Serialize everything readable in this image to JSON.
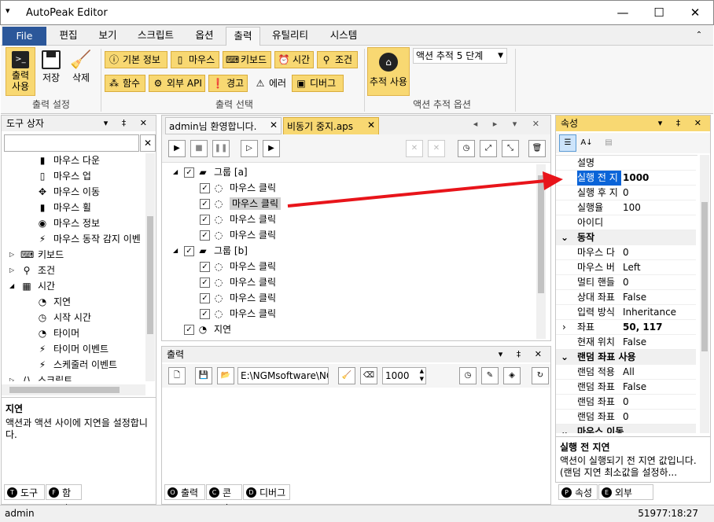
{
  "window": {
    "title": "AutoPeak Editor",
    "min": "—",
    "max": "☐",
    "close": "✕"
  },
  "menu": {
    "tabs": [
      "File",
      "편집",
      "보기",
      "스크립트",
      "옵션",
      "출력",
      "유틸리티",
      "시스템"
    ]
  },
  "ribbon": {
    "output_use": "출력\n사용",
    "save": "저장",
    "clear": "삭제",
    "group1": "출력 설정",
    "small": [
      "기본 정보",
      "마우스",
      "키보드",
      "시간",
      "조건",
      "함수",
      "외부 API",
      "경고",
      "에러",
      "디버그"
    ],
    "group2": "출력 선택",
    "trace_use": "추적 사용",
    "trace_level": "액션 추적 5 단계",
    "group3": "액션 추적 옵션"
  },
  "toolbox": {
    "title": "도구 상자",
    "items": [
      "마우스 다운",
      "마우스 업",
      "마우스 이동",
      "마우스 휠",
      "마우스 정보",
      "마우스 동작 감지 이벤",
      "키보드",
      "조건",
      "시간",
      "지연",
      "시작 시간",
      "타이머",
      "타이머 이벤트",
      "스케줄러 이벤트",
      "스크립트"
    ],
    "desc_title": "지연",
    "desc_text": "액션과 액션 사이에 지연을 설정합니다.",
    "tabs": [
      "도구",
      "함수"
    ],
    "tab_badges": [
      "T",
      "F"
    ]
  },
  "editor": {
    "tabs": [
      "admin님 환영합니다.",
      "비동기 중지.aps"
    ],
    "rows": [
      "그룹 [a]",
      "마우스 클릭",
      "마우스 클릭",
      "마우스 클릭",
      "마우스 클릭",
      "그룹 [b]",
      "마우스 클릭",
      "마우스 클릭",
      "마우스 클릭",
      "마우스 클릭",
      "지연"
    ]
  },
  "output": {
    "title": "출력",
    "path": "E:\\NGMsoftware\\NG",
    "count": "1000",
    "tabs": [
      "출력",
      "콘솔",
      "디버그"
    ],
    "tab_badges": [
      "O",
      "C",
      "D"
    ]
  },
  "properties": {
    "title": "속성",
    "rows": [
      {
        "k": "설명",
        "v": ""
      },
      {
        "k": "실행 전 지",
        "v": "1000"
      },
      {
        "k": "실행 후 지",
        "v": "0"
      },
      {
        "k": "실행율",
        "v": "100"
      },
      {
        "k": "아이디",
        "v": ""
      },
      {
        "k": "동작",
        "v": ""
      },
      {
        "k": "마우스 다",
        "v": "0"
      },
      {
        "k": "마우스 버",
        "v": "Left"
      },
      {
        "k": "멀티 핸들",
        "v": "0"
      },
      {
        "k": "상대 좌표",
        "v": "False"
      },
      {
        "k": "입력 방식",
        "v": "Inheritance"
      },
      {
        "k": "좌표",
        "v": "50, 117"
      },
      {
        "k": "현재 위치",
        "v": "False"
      },
      {
        "k": "랜덤 좌표 사용",
        "v": ""
      },
      {
        "k": "랜덤 적용",
        "v": "All"
      },
      {
        "k": "랜덤 좌표",
        "v": "False"
      },
      {
        "k": "랜덤 좌표",
        "v": "0"
      },
      {
        "k": "랜덤 좌표",
        "v": "0"
      },
      {
        "k": "마우스 이동",
        "v": ""
      }
    ],
    "desc_title": "실행 전 지연",
    "desc_text": "액션이 실행되기 전 지연 값입니다. (랜덤 지연 최소값을 설정하...",
    "tabs": [
      "속성",
      "외부 API"
    ],
    "tab_badges": [
      "P",
      "E"
    ]
  },
  "status": {
    "user": "admin",
    "time": "51977:18:27"
  },
  "colors": {
    "accent": "#2b579a",
    "highlight": "#f8d872",
    "arrow": "#e8141a",
    "selected": "#0a64d8"
  }
}
